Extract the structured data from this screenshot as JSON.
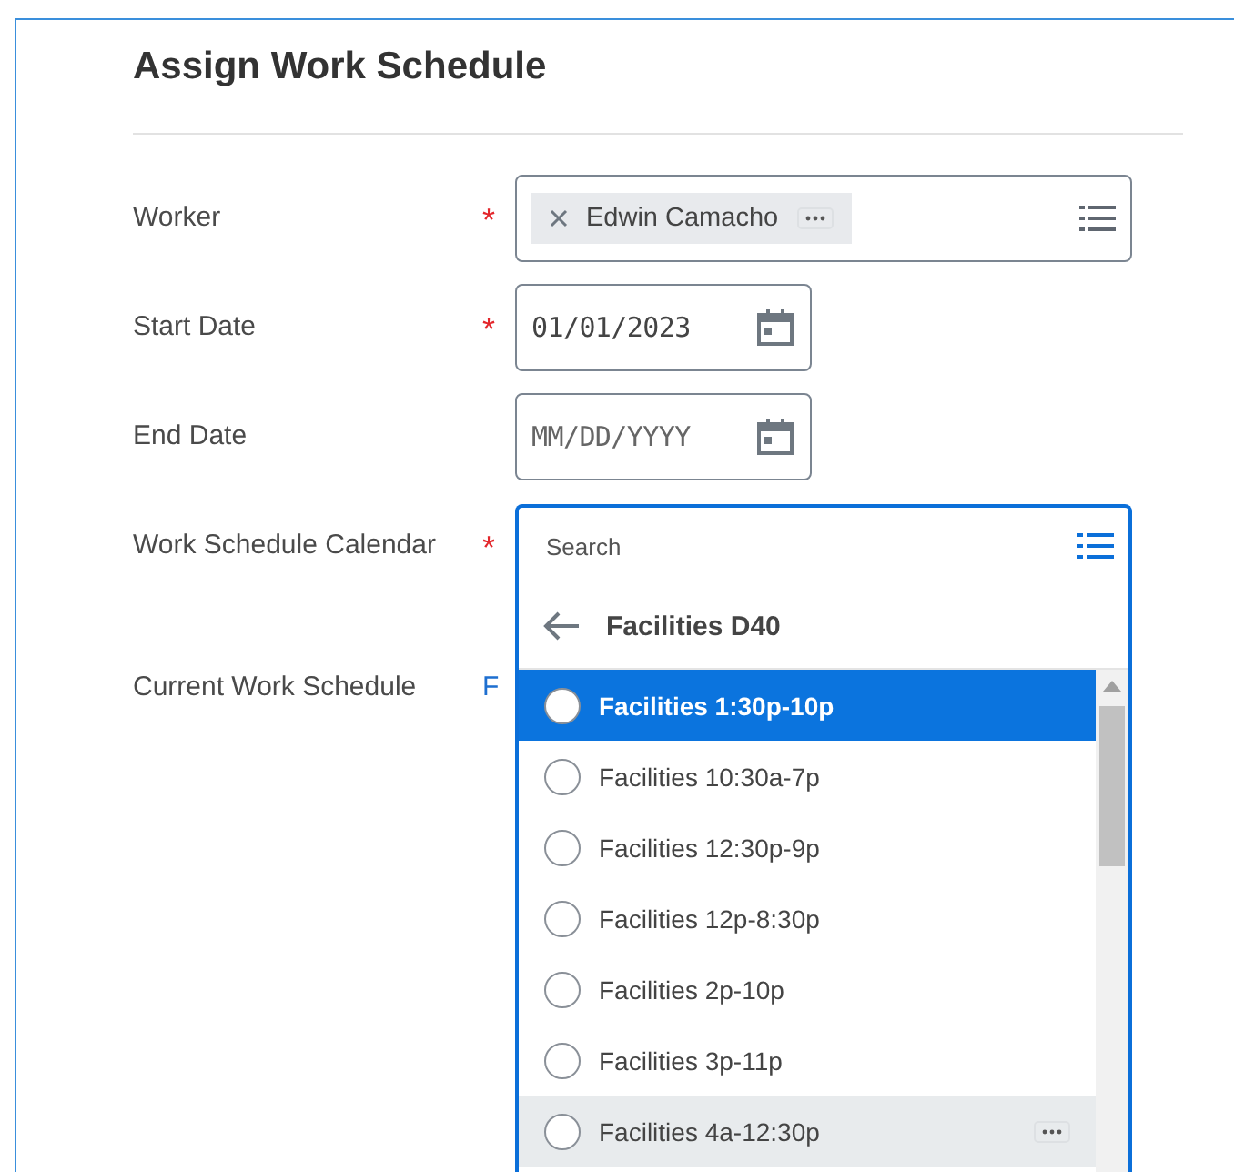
{
  "title": "Assign Work Schedule",
  "fields": [
    {
      "kind": "prompt",
      "label": "Worker",
      "required_mark": "*",
      "token": "Edwin Camacho"
    },
    {
      "kind": "date",
      "label": "Start Date",
      "required_mark": "*",
      "value": "01/01/2023"
    },
    {
      "kind": "date",
      "label": "End Date",
      "placeholder": "MM/DD/YYYY"
    },
    {
      "kind": "calendar",
      "label": "Work Schedule Calendar",
      "required_mark": "*"
    },
    {
      "kind": "display",
      "label": "Current Work Schedule",
      "link": "F"
    }
  ],
  "dropdown": {
    "placeholder": "Search",
    "category": "Facilities D40",
    "options": [
      {
        "label": "Facilities 1:30p-10p",
        "selected": true,
        "hovered": false
      },
      {
        "label": "Facilities 10:30a-7p",
        "selected": false,
        "hovered": false
      },
      {
        "label": "Facilities 12:30p-9p",
        "selected": false,
        "hovered": false
      },
      {
        "label": "Facilities 12p-8:30p",
        "selected": false,
        "hovered": false
      },
      {
        "label": "Facilities 2p-10p",
        "selected": false,
        "hovered": false
      },
      {
        "label": "Facilities 3p-11p",
        "selected": false,
        "hovered": false
      },
      {
        "label": "Facilities 4a-12:30p",
        "selected": false,
        "hovered": true
      }
    ]
  }
}
